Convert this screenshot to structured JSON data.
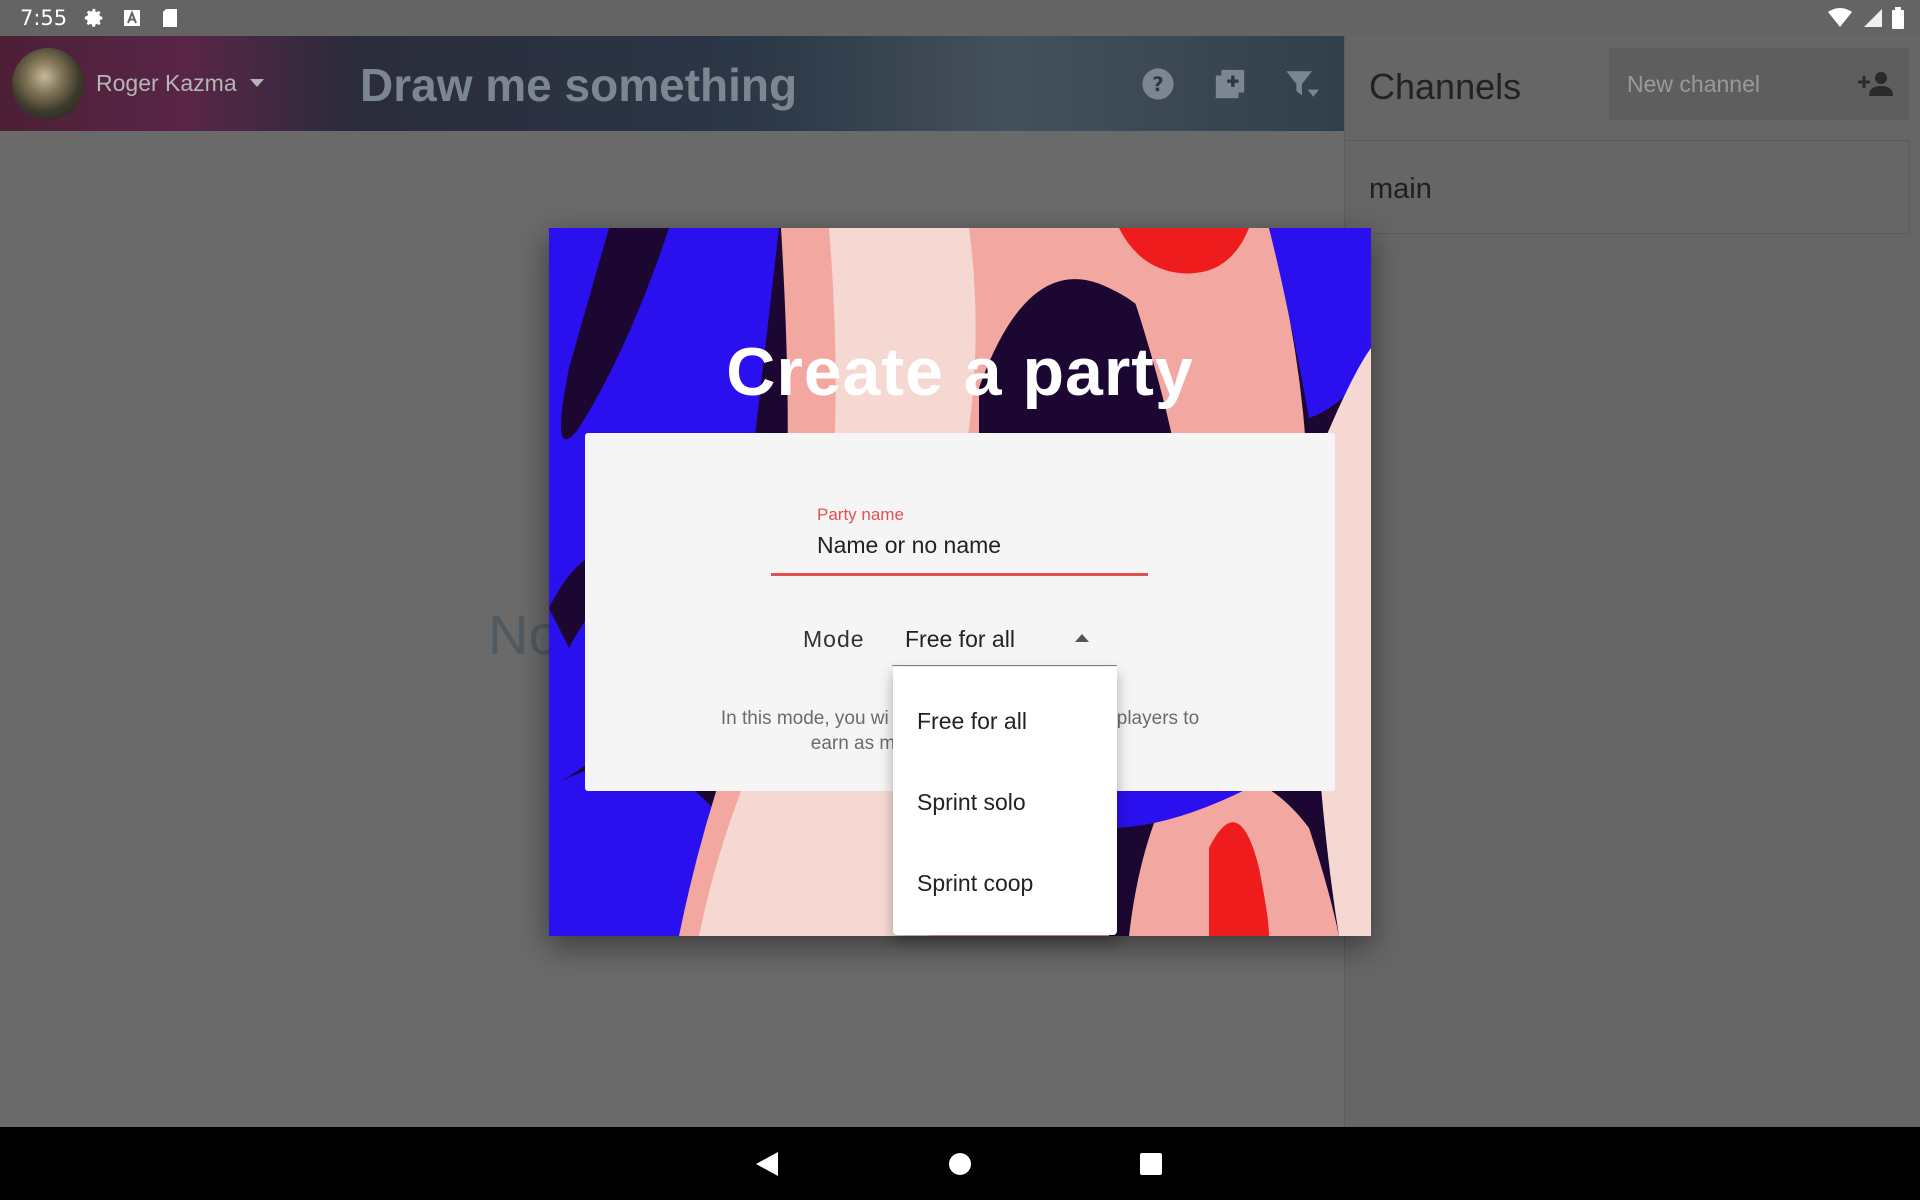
{
  "statusbar": {
    "time": "7:55"
  },
  "header": {
    "username": "Roger Kazma",
    "title": "Draw me something",
    "icons": [
      "help-icon",
      "add-box-icon",
      "filter-icon"
    ]
  },
  "background": {
    "partial_text": "No"
  },
  "sidebar": {
    "title": "Channels",
    "new_channel_placeholder": "New channel",
    "channels": [
      "main"
    ]
  },
  "dialog": {
    "title": "Create a party",
    "party_name_label": "Party name",
    "party_name_value": "Name or no name",
    "mode_label": "Mode",
    "mode_selected": "Free for all",
    "description_line1_left": "In this mode, you wi",
    "description_line1_right": "players to",
    "description_line2": "earn as m",
    "mode_options": [
      "Free for all",
      "Sprint solo",
      "Sprint coop"
    ]
  },
  "colors": {
    "accent_red": "#e05252",
    "art_blue": "#2a10ee",
    "art_dark": "#1c0732",
    "art_pink": "#f2a7a0",
    "art_light": "#f6d8d3",
    "art_red": "#ee1c1c"
  }
}
